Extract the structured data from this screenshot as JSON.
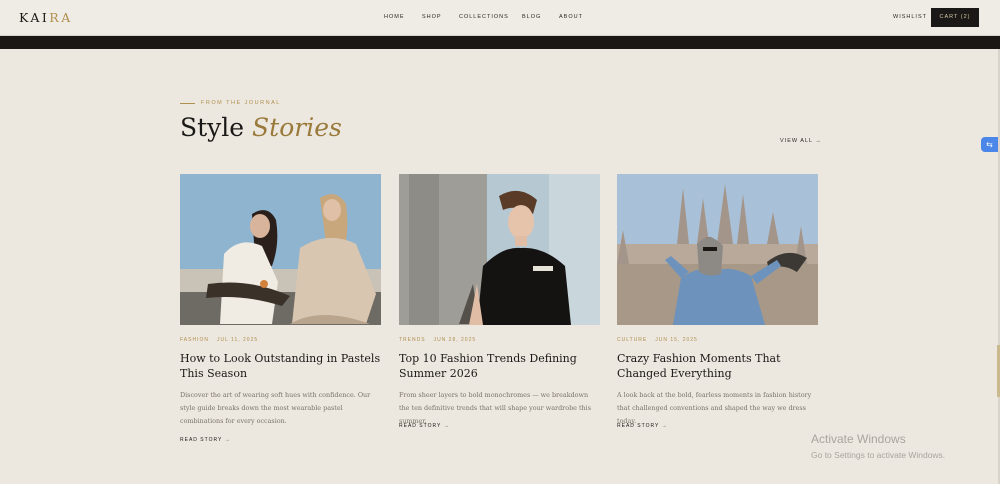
{
  "brand": {
    "logo_a": "KAI",
    "logo_b": "RA"
  },
  "nav": {
    "home": "HOME",
    "shop": "SHOP",
    "collections": "COLLECTIONS",
    "blog": "BLOG",
    "about": "ABOUT"
  },
  "header_right": {
    "wishlist": "WISHLIST",
    "cart": "CART (2)"
  },
  "section": {
    "eyebrow": "FROM THE JOURNAL",
    "title_plain": "Style",
    "title_em": "Stories",
    "view_all": "VIEW ALL →"
  },
  "cards": [
    {
      "category": "FASHION",
      "date": "JUL 11, 2025",
      "title": "How to Look Outstanding in Pastels This Season",
      "excerpt": "Discover the art of wearing soft hues with confidence. Our style guide breaks down the most wearable pastel combinations for every occasion.",
      "cta": "READ STORY →"
    },
    {
      "category": "TRENDS",
      "date": "JUN 28, 2025",
      "title": "Top 10 Fashion Trends Defining Summer 2026",
      "excerpt": "From sheer layers to bold monochromes — we breakdown the ten definitive trends that will shape your wardrobe this summer.",
      "cta": "READ STORY →"
    },
    {
      "category": "CULTURE",
      "date": "JUN 15, 2025",
      "title": "Crazy Fashion Moments That Changed Everything",
      "excerpt": "A look back at the bold, fearless moments in fashion history that challenged conventions and shaped the way we dress today.",
      "cta": "READ STORY →"
    }
  ],
  "watermark": {
    "title": "Activate Windows",
    "subtitle": "Go to Settings to activate Windows."
  },
  "colors": {
    "accent": "#b0904f",
    "background": "#ece7df",
    "dark": "#1b1917"
  },
  "icons": {
    "translate": "translate-icon"
  }
}
